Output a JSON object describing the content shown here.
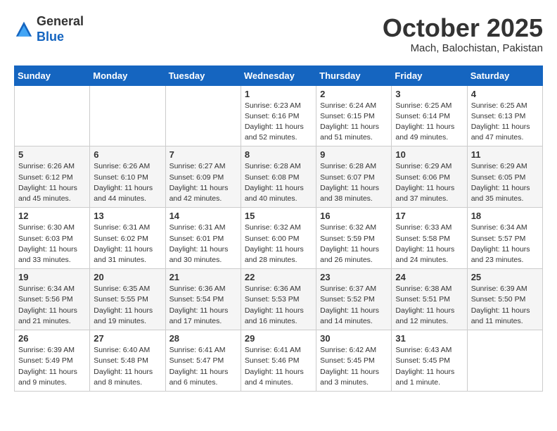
{
  "header": {
    "logo_general": "General",
    "logo_blue": "Blue",
    "month_title": "October 2025",
    "location": "Mach, Balochistan, Pakistan"
  },
  "weekdays": [
    "Sunday",
    "Monday",
    "Tuesday",
    "Wednesday",
    "Thursday",
    "Friday",
    "Saturday"
  ],
  "weeks": [
    [
      {
        "day": "",
        "info": ""
      },
      {
        "day": "",
        "info": ""
      },
      {
        "day": "",
        "info": ""
      },
      {
        "day": "1",
        "info": "Sunrise: 6:23 AM\nSunset: 6:16 PM\nDaylight: 11 hours\nand 52 minutes."
      },
      {
        "day": "2",
        "info": "Sunrise: 6:24 AM\nSunset: 6:15 PM\nDaylight: 11 hours\nand 51 minutes."
      },
      {
        "day": "3",
        "info": "Sunrise: 6:25 AM\nSunset: 6:14 PM\nDaylight: 11 hours\nand 49 minutes."
      },
      {
        "day": "4",
        "info": "Sunrise: 6:25 AM\nSunset: 6:13 PM\nDaylight: 11 hours\nand 47 minutes."
      }
    ],
    [
      {
        "day": "5",
        "info": "Sunrise: 6:26 AM\nSunset: 6:12 PM\nDaylight: 11 hours\nand 45 minutes."
      },
      {
        "day": "6",
        "info": "Sunrise: 6:26 AM\nSunset: 6:10 PM\nDaylight: 11 hours\nand 44 minutes."
      },
      {
        "day": "7",
        "info": "Sunrise: 6:27 AM\nSunset: 6:09 PM\nDaylight: 11 hours\nand 42 minutes."
      },
      {
        "day": "8",
        "info": "Sunrise: 6:28 AM\nSunset: 6:08 PM\nDaylight: 11 hours\nand 40 minutes."
      },
      {
        "day": "9",
        "info": "Sunrise: 6:28 AM\nSunset: 6:07 PM\nDaylight: 11 hours\nand 38 minutes."
      },
      {
        "day": "10",
        "info": "Sunrise: 6:29 AM\nSunset: 6:06 PM\nDaylight: 11 hours\nand 37 minutes."
      },
      {
        "day": "11",
        "info": "Sunrise: 6:29 AM\nSunset: 6:05 PM\nDaylight: 11 hours\nand 35 minutes."
      }
    ],
    [
      {
        "day": "12",
        "info": "Sunrise: 6:30 AM\nSunset: 6:03 PM\nDaylight: 11 hours\nand 33 minutes."
      },
      {
        "day": "13",
        "info": "Sunrise: 6:31 AM\nSunset: 6:02 PM\nDaylight: 11 hours\nand 31 minutes."
      },
      {
        "day": "14",
        "info": "Sunrise: 6:31 AM\nSunset: 6:01 PM\nDaylight: 11 hours\nand 30 minutes."
      },
      {
        "day": "15",
        "info": "Sunrise: 6:32 AM\nSunset: 6:00 PM\nDaylight: 11 hours\nand 28 minutes."
      },
      {
        "day": "16",
        "info": "Sunrise: 6:32 AM\nSunset: 5:59 PM\nDaylight: 11 hours\nand 26 minutes."
      },
      {
        "day": "17",
        "info": "Sunrise: 6:33 AM\nSunset: 5:58 PM\nDaylight: 11 hours\nand 24 minutes."
      },
      {
        "day": "18",
        "info": "Sunrise: 6:34 AM\nSunset: 5:57 PM\nDaylight: 11 hours\nand 23 minutes."
      }
    ],
    [
      {
        "day": "19",
        "info": "Sunrise: 6:34 AM\nSunset: 5:56 PM\nDaylight: 11 hours\nand 21 minutes."
      },
      {
        "day": "20",
        "info": "Sunrise: 6:35 AM\nSunset: 5:55 PM\nDaylight: 11 hours\nand 19 minutes."
      },
      {
        "day": "21",
        "info": "Sunrise: 6:36 AM\nSunset: 5:54 PM\nDaylight: 11 hours\nand 17 minutes."
      },
      {
        "day": "22",
        "info": "Sunrise: 6:36 AM\nSunset: 5:53 PM\nDaylight: 11 hours\nand 16 minutes."
      },
      {
        "day": "23",
        "info": "Sunrise: 6:37 AM\nSunset: 5:52 PM\nDaylight: 11 hours\nand 14 minutes."
      },
      {
        "day": "24",
        "info": "Sunrise: 6:38 AM\nSunset: 5:51 PM\nDaylight: 11 hours\nand 12 minutes."
      },
      {
        "day": "25",
        "info": "Sunrise: 6:39 AM\nSunset: 5:50 PM\nDaylight: 11 hours\nand 11 minutes."
      }
    ],
    [
      {
        "day": "26",
        "info": "Sunrise: 6:39 AM\nSunset: 5:49 PM\nDaylight: 11 hours\nand 9 minutes."
      },
      {
        "day": "27",
        "info": "Sunrise: 6:40 AM\nSunset: 5:48 PM\nDaylight: 11 hours\nand 8 minutes."
      },
      {
        "day": "28",
        "info": "Sunrise: 6:41 AM\nSunset: 5:47 PM\nDaylight: 11 hours\nand 6 minutes."
      },
      {
        "day": "29",
        "info": "Sunrise: 6:41 AM\nSunset: 5:46 PM\nDaylight: 11 hours\nand 4 minutes."
      },
      {
        "day": "30",
        "info": "Sunrise: 6:42 AM\nSunset: 5:45 PM\nDaylight: 11 hours\nand 3 minutes."
      },
      {
        "day": "31",
        "info": "Sunrise: 6:43 AM\nSunset: 5:45 PM\nDaylight: 11 hours\nand 1 minute."
      },
      {
        "day": "",
        "info": ""
      }
    ]
  ]
}
